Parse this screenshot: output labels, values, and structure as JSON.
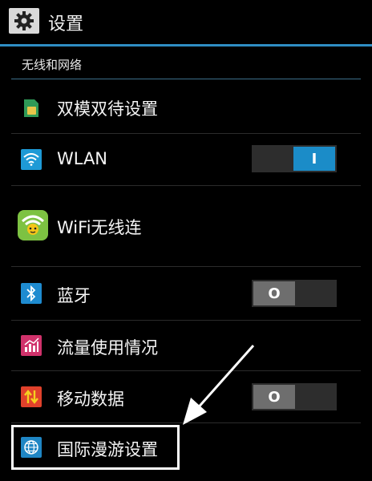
{
  "header": {
    "title": "设置",
    "icon": "gear-icon"
  },
  "section": {
    "title": "无线和网络"
  },
  "items": [
    {
      "label": "双模双待设置",
      "icon": "sim-card-icon"
    },
    {
      "label": "WLAN",
      "icon": "wifi-icon",
      "toggle": "on",
      "toggle_symbol": "I"
    },
    {
      "label": "WiFi无线连",
      "icon": "wifi-app-icon"
    },
    {
      "label": "蓝牙",
      "icon": "bluetooth-icon",
      "toggle": "off",
      "toggle_symbol": "O"
    },
    {
      "label": "流量使用情况",
      "icon": "data-usage-icon"
    },
    {
      "label": "移动数据",
      "icon": "mobile-data-icon",
      "toggle": "off",
      "toggle_symbol": "O"
    },
    {
      "label": "国际漫游设置",
      "icon": "globe-icon"
    }
  ],
  "colors": {
    "accent": "#2f8ec4",
    "toggle_on": "#1b8cc8",
    "background": "#000000"
  }
}
